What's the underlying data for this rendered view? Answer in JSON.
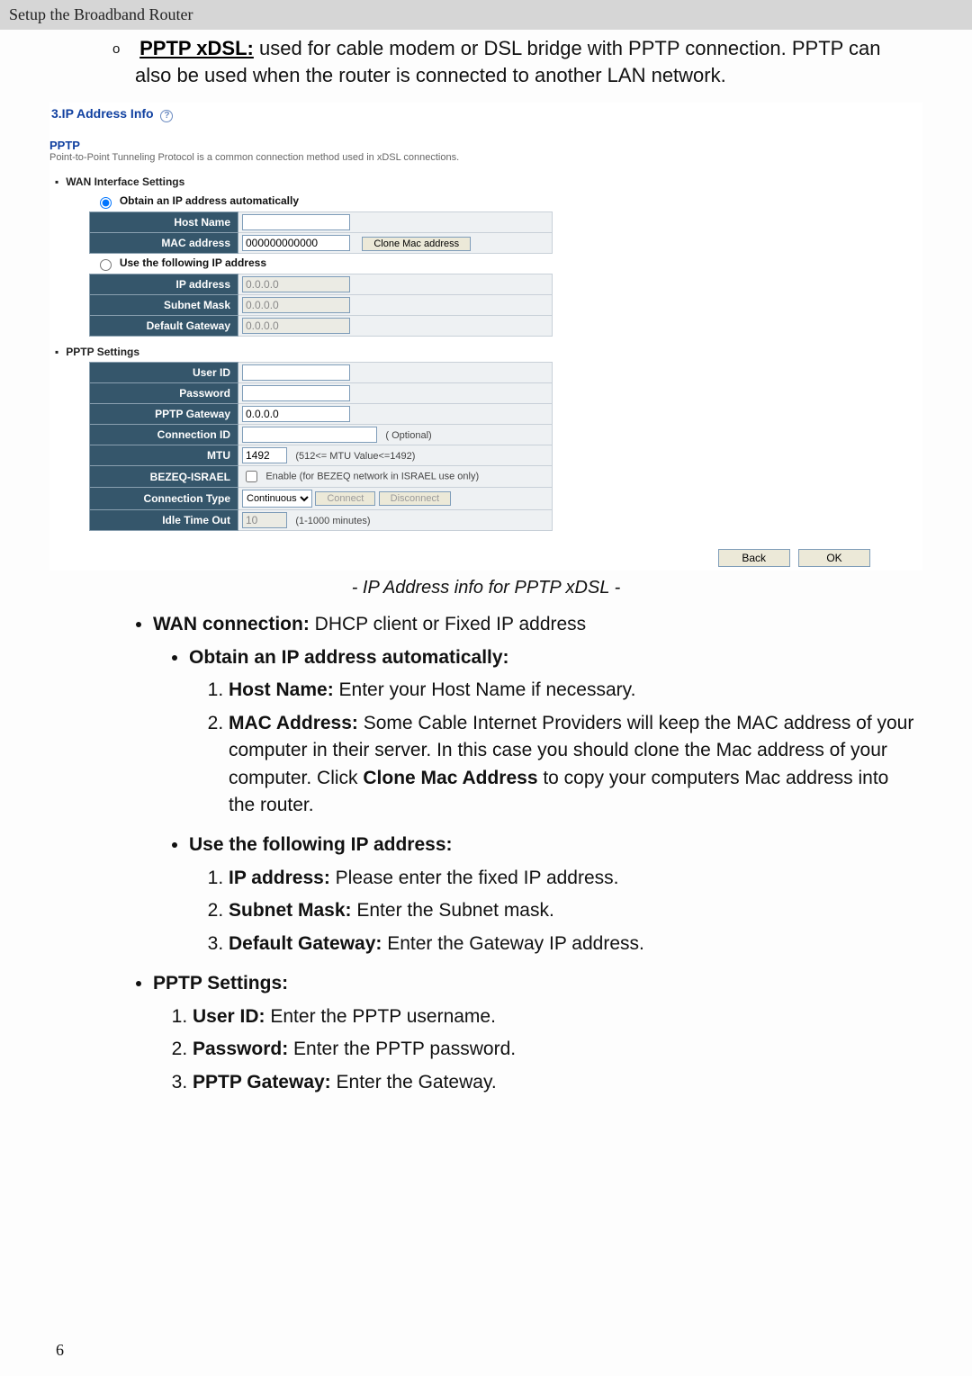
{
  "top_bar": "Setup the Broadband Router",
  "intro": {
    "link_text": "PPTP xDSL:",
    "rest": " used for cable modem or DSL bridge with PPTP connection. PPTP can also be used when the router is connected to another LAN network."
  },
  "panel": {
    "section_title": "3.IP Address Info",
    "help_glyph": "?",
    "subheading": "PPTP",
    "desc": "Point-to-Point Tunneling Protocol is a common connection method used in xDSL connections.",
    "wan_title": "WAN Interface Settings",
    "radio_auto": "Obtain an IP address automatically",
    "radio_static": "Use the following IP address",
    "labels": {
      "host_name": "Host Name",
      "mac": "MAC address",
      "ip": "IP address",
      "subnet": "Subnet Mask",
      "gw": "Default Gateway",
      "user": "User ID",
      "pass": "Password",
      "pptp_gw": "PPTP Gateway",
      "conn_id": "Connection ID",
      "mtu": "MTU",
      "bezeq": "BEZEQ-ISRAEL",
      "conn_type": "Connection Type",
      "idle": "Idle Time Out"
    },
    "values": {
      "host_name": "",
      "mac": "000000000000",
      "ip": "0.0.0.0",
      "subnet": "0.0.0.0",
      "gw": "0.0.0.0",
      "user": "",
      "pass": "",
      "pptp_gw": "0.0.0.0",
      "conn_id": "",
      "mtu": "1492",
      "idle": "10",
      "conn_type_selected": "Continuous"
    },
    "hints": {
      "conn_id": "( Optional)",
      "mtu": "(512<= MTU Value<=1492)",
      "bezeq": "Enable (for BEZEQ network in ISRAEL use only)",
      "idle": "(1-1000 minutes)"
    },
    "buttons": {
      "clone": "Clone Mac address",
      "connect": "Connect",
      "disconnect": "Disconnect",
      "back": "Back",
      "ok": "OK"
    },
    "pptp_title": "PPTP Settings"
  },
  "caption": "- IP Address info for PPTP xDSL -",
  "doc": {
    "wan_conn_label": "WAN connection:",
    "wan_conn_text": " DHCP client or Fixed IP address",
    "auto_title": "Obtain an IP address automatically:",
    "auto_items": [
      {
        "b": "Host Name:",
        "t": " Enter your Host Name if necessary."
      },
      {
        "b": "MAC Address:",
        "t": " Some Cable Internet Providers will keep the MAC address of your computer in their server. In this case you should clone the Mac address of your computer. Click ",
        "b2": "Clone Mac Address",
        "t2": " to copy your computers Mac address into the router."
      }
    ],
    "static_title": "Use the following IP address:",
    "static_items": [
      {
        "b": "IP address:",
        "t": " Please enter the fixed IP address."
      },
      {
        "b": "Subnet Mask:",
        "t": " Enter the Subnet mask."
      },
      {
        "b": "Default Gateway:",
        "t": " Enter the Gateway IP address."
      }
    ],
    "pptp_set_title": "PPTP Settings:",
    "pptp_items": [
      {
        "b": "User ID:",
        "t": " Enter the PPTP username."
      },
      {
        "b": "Password:",
        "t": " Enter the PPTP password."
      },
      {
        "b": "PPTP Gateway:",
        "t": " Enter the Gateway."
      }
    ]
  },
  "page_number": "6"
}
